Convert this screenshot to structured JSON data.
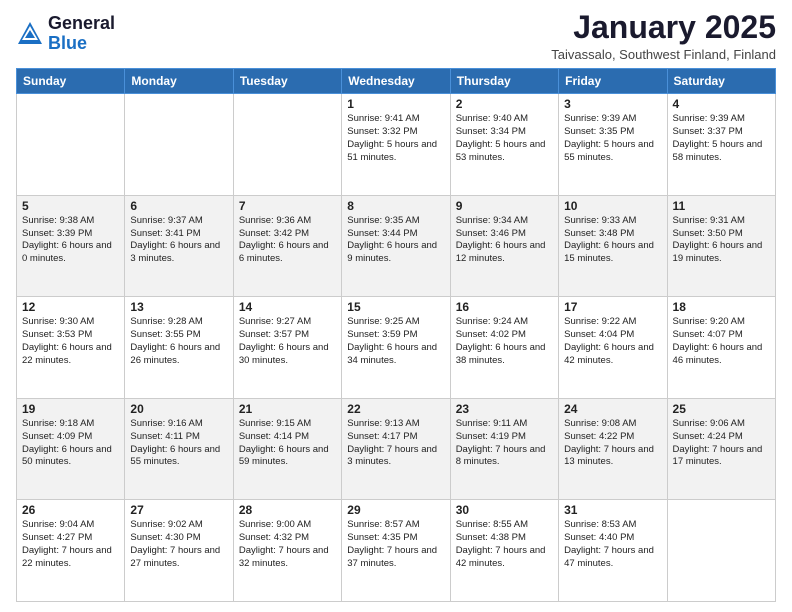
{
  "logo": {
    "general": "General",
    "blue": "Blue"
  },
  "title": "January 2025",
  "location": "Taivassalo, Southwest Finland, Finland",
  "days_of_week": [
    "Sunday",
    "Monday",
    "Tuesday",
    "Wednesday",
    "Thursday",
    "Friday",
    "Saturday"
  ],
  "weeks": [
    [
      {
        "day": "",
        "info": ""
      },
      {
        "day": "",
        "info": ""
      },
      {
        "day": "",
        "info": ""
      },
      {
        "day": "1",
        "info": "Sunrise: 9:41 AM\nSunset: 3:32 PM\nDaylight: 5 hours and 51 minutes."
      },
      {
        "day": "2",
        "info": "Sunrise: 9:40 AM\nSunset: 3:34 PM\nDaylight: 5 hours and 53 minutes."
      },
      {
        "day": "3",
        "info": "Sunrise: 9:39 AM\nSunset: 3:35 PM\nDaylight: 5 hours and 55 minutes."
      },
      {
        "day": "4",
        "info": "Sunrise: 9:39 AM\nSunset: 3:37 PM\nDaylight: 5 hours and 58 minutes."
      }
    ],
    [
      {
        "day": "5",
        "info": "Sunrise: 9:38 AM\nSunset: 3:39 PM\nDaylight: 6 hours and 0 minutes."
      },
      {
        "day": "6",
        "info": "Sunrise: 9:37 AM\nSunset: 3:41 PM\nDaylight: 6 hours and 3 minutes."
      },
      {
        "day": "7",
        "info": "Sunrise: 9:36 AM\nSunset: 3:42 PM\nDaylight: 6 hours and 6 minutes."
      },
      {
        "day": "8",
        "info": "Sunrise: 9:35 AM\nSunset: 3:44 PM\nDaylight: 6 hours and 9 minutes."
      },
      {
        "day": "9",
        "info": "Sunrise: 9:34 AM\nSunset: 3:46 PM\nDaylight: 6 hours and 12 minutes."
      },
      {
        "day": "10",
        "info": "Sunrise: 9:33 AM\nSunset: 3:48 PM\nDaylight: 6 hours and 15 minutes."
      },
      {
        "day": "11",
        "info": "Sunrise: 9:31 AM\nSunset: 3:50 PM\nDaylight: 6 hours and 19 minutes."
      }
    ],
    [
      {
        "day": "12",
        "info": "Sunrise: 9:30 AM\nSunset: 3:53 PM\nDaylight: 6 hours and 22 minutes."
      },
      {
        "day": "13",
        "info": "Sunrise: 9:28 AM\nSunset: 3:55 PM\nDaylight: 6 hours and 26 minutes."
      },
      {
        "day": "14",
        "info": "Sunrise: 9:27 AM\nSunset: 3:57 PM\nDaylight: 6 hours and 30 minutes."
      },
      {
        "day": "15",
        "info": "Sunrise: 9:25 AM\nSunset: 3:59 PM\nDaylight: 6 hours and 34 minutes."
      },
      {
        "day": "16",
        "info": "Sunrise: 9:24 AM\nSunset: 4:02 PM\nDaylight: 6 hours and 38 minutes."
      },
      {
        "day": "17",
        "info": "Sunrise: 9:22 AM\nSunset: 4:04 PM\nDaylight: 6 hours and 42 minutes."
      },
      {
        "day": "18",
        "info": "Sunrise: 9:20 AM\nSunset: 4:07 PM\nDaylight: 6 hours and 46 minutes."
      }
    ],
    [
      {
        "day": "19",
        "info": "Sunrise: 9:18 AM\nSunset: 4:09 PM\nDaylight: 6 hours and 50 minutes."
      },
      {
        "day": "20",
        "info": "Sunrise: 9:16 AM\nSunset: 4:11 PM\nDaylight: 6 hours and 55 minutes."
      },
      {
        "day": "21",
        "info": "Sunrise: 9:15 AM\nSunset: 4:14 PM\nDaylight: 6 hours and 59 minutes."
      },
      {
        "day": "22",
        "info": "Sunrise: 9:13 AM\nSunset: 4:17 PM\nDaylight: 7 hours and 3 minutes."
      },
      {
        "day": "23",
        "info": "Sunrise: 9:11 AM\nSunset: 4:19 PM\nDaylight: 7 hours and 8 minutes."
      },
      {
        "day": "24",
        "info": "Sunrise: 9:08 AM\nSunset: 4:22 PM\nDaylight: 7 hours and 13 minutes."
      },
      {
        "day": "25",
        "info": "Sunrise: 9:06 AM\nSunset: 4:24 PM\nDaylight: 7 hours and 17 minutes."
      }
    ],
    [
      {
        "day": "26",
        "info": "Sunrise: 9:04 AM\nSunset: 4:27 PM\nDaylight: 7 hours and 22 minutes."
      },
      {
        "day": "27",
        "info": "Sunrise: 9:02 AM\nSunset: 4:30 PM\nDaylight: 7 hours and 27 minutes."
      },
      {
        "day": "28",
        "info": "Sunrise: 9:00 AM\nSunset: 4:32 PM\nDaylight: 7 hours and 32 minutes."
      },
      {
        "day": "29",
        "info": "Sunrise: 8:57 AM\nSunset: 4:35 PM\nDaylight: 7 hours and 37 minutes."
      },
      {
        "day": "30",
        "info": "Sunrise: 8:55 AM\nSunset: 4:38 PM\nDaylight: 7 hours and 42 minutes."
      },
      {
        "day": "31",
        "info": "Sunrise: 8:53 AM\nSunset: 4:40 PM\nDaylight: 7 hours and 47 minutes."
      },
      {
        "day": "",
        "info": ""
      }
    ]
  ]
}
